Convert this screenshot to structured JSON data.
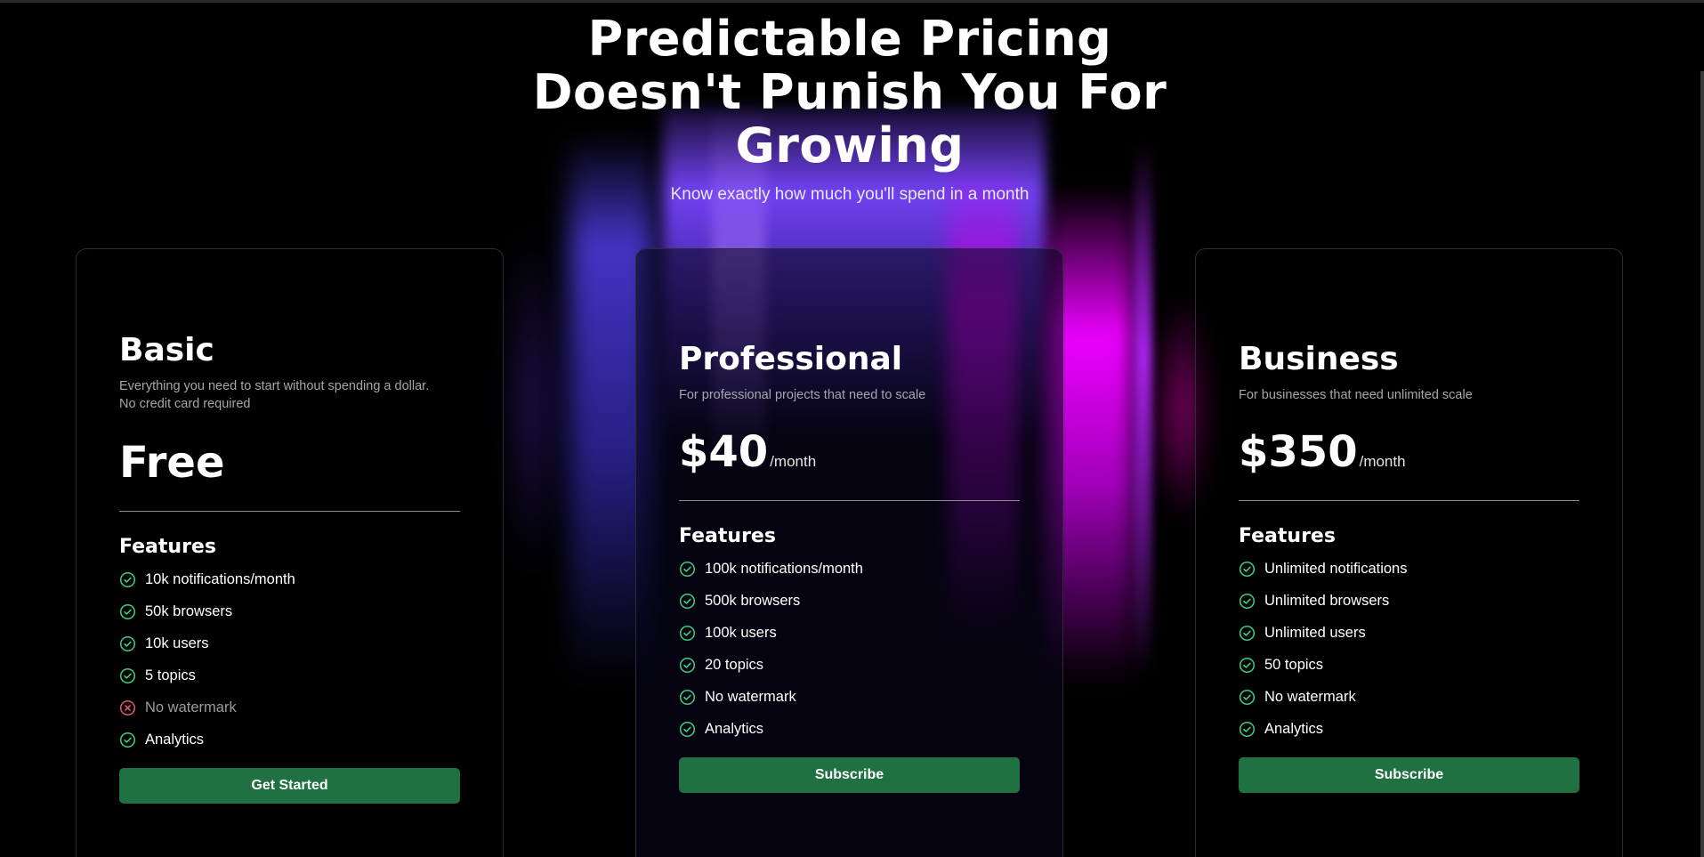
{
  "hero": {
    "title_line1": "Predictable Pricing",
    "title_line2": "Doesn't Punish You For",
    "title_line3": "Growing",
    "subtitle": "Know exactly how much you'll spend in a month"
  },
  "colors": {
    "background": "#000000",
    "button": "#1f7141",
    "check": "#3fcf7f",
    "cross": "#e05a6a",
    "glow_blue": "#5a40e6",
    "glow_magenta": "#ec00ff"
  },
  "plans": [
    {
      "name": "Basic",
      "description_line1": "Everything you need to start without spending a dollar.",
      "description_line2": "No credit card required",
      "price": "Free",
      "period": "",
      "features_title": "Features",
      "features": [
        {
          "label": "10k notifications/month",
          "icon": "check-circle-icon"
        },
        {
          "label": "50k browsers",
          "icon": "check-circle-icon"
        },
        {
          "label": "10k users",
          "icon": "check-circle-icon"
        },
        {
          "label": "5 topics",
          "icon": "check-circle-icon"
        },
        {
          "label": "No watermark",
          "icon": "x-circle-icon"
        },
        {
          "label": "Analytics",
          "icon": "check-circle-icon"
        }
      ],
      "button": "Get Started"
    },
    {
      "name": "Professional",
      "description_line1": "For professional projects that need to scale",
      "price": "$40",
      "period": "/month",
      "features_title": "Features",
      "features": [
        {
          "label": "100k notifications/month",
          "icon": "check-circle-icon"
        },
        {
          "label": "500k browsers",
          "icon": "check-circle-icon"
        },
        {
          "label": "100k users",
          "icon": "check-circle-icon"
        },
        {
          "label": "20 topics",
          "icon": "check-circle-icon"
        },
        {
          "label": "No watermark",
          "icon": "check-circle-icon"
        },
        {
          "label": "Analytics",
          "icon": "check-circle-icon"
        }
      ],
      "button": "Subscribe"
    },
    {
      "name": "Business",
      "description_line1": "For businesses that need unlimited scale",
      "price": "$350",
      "period": "/month",
      "features_title": "Features",
      "features": [
        {
          "label": "Unlimited notifications",
          "icon": "check-circle-icon"
        },
        {
          "label": "Unlimited browsers",
          "icon": "check-circle-icon"
        },
        {
          "label": "Unlimited users",
          "icon": "check-circle-icon"
        },
        {
          "label": "50 topics",
          "icon": "check-circle-icon"
        },
        {
          "label": "No watermark",
          "icon": "check-circle-icon"
        },
        {
          "label": "Analytics",
          "icon": "check-circle-icon"
        }
      ],
      "button": "Subscribe"
    }
  ]
}
